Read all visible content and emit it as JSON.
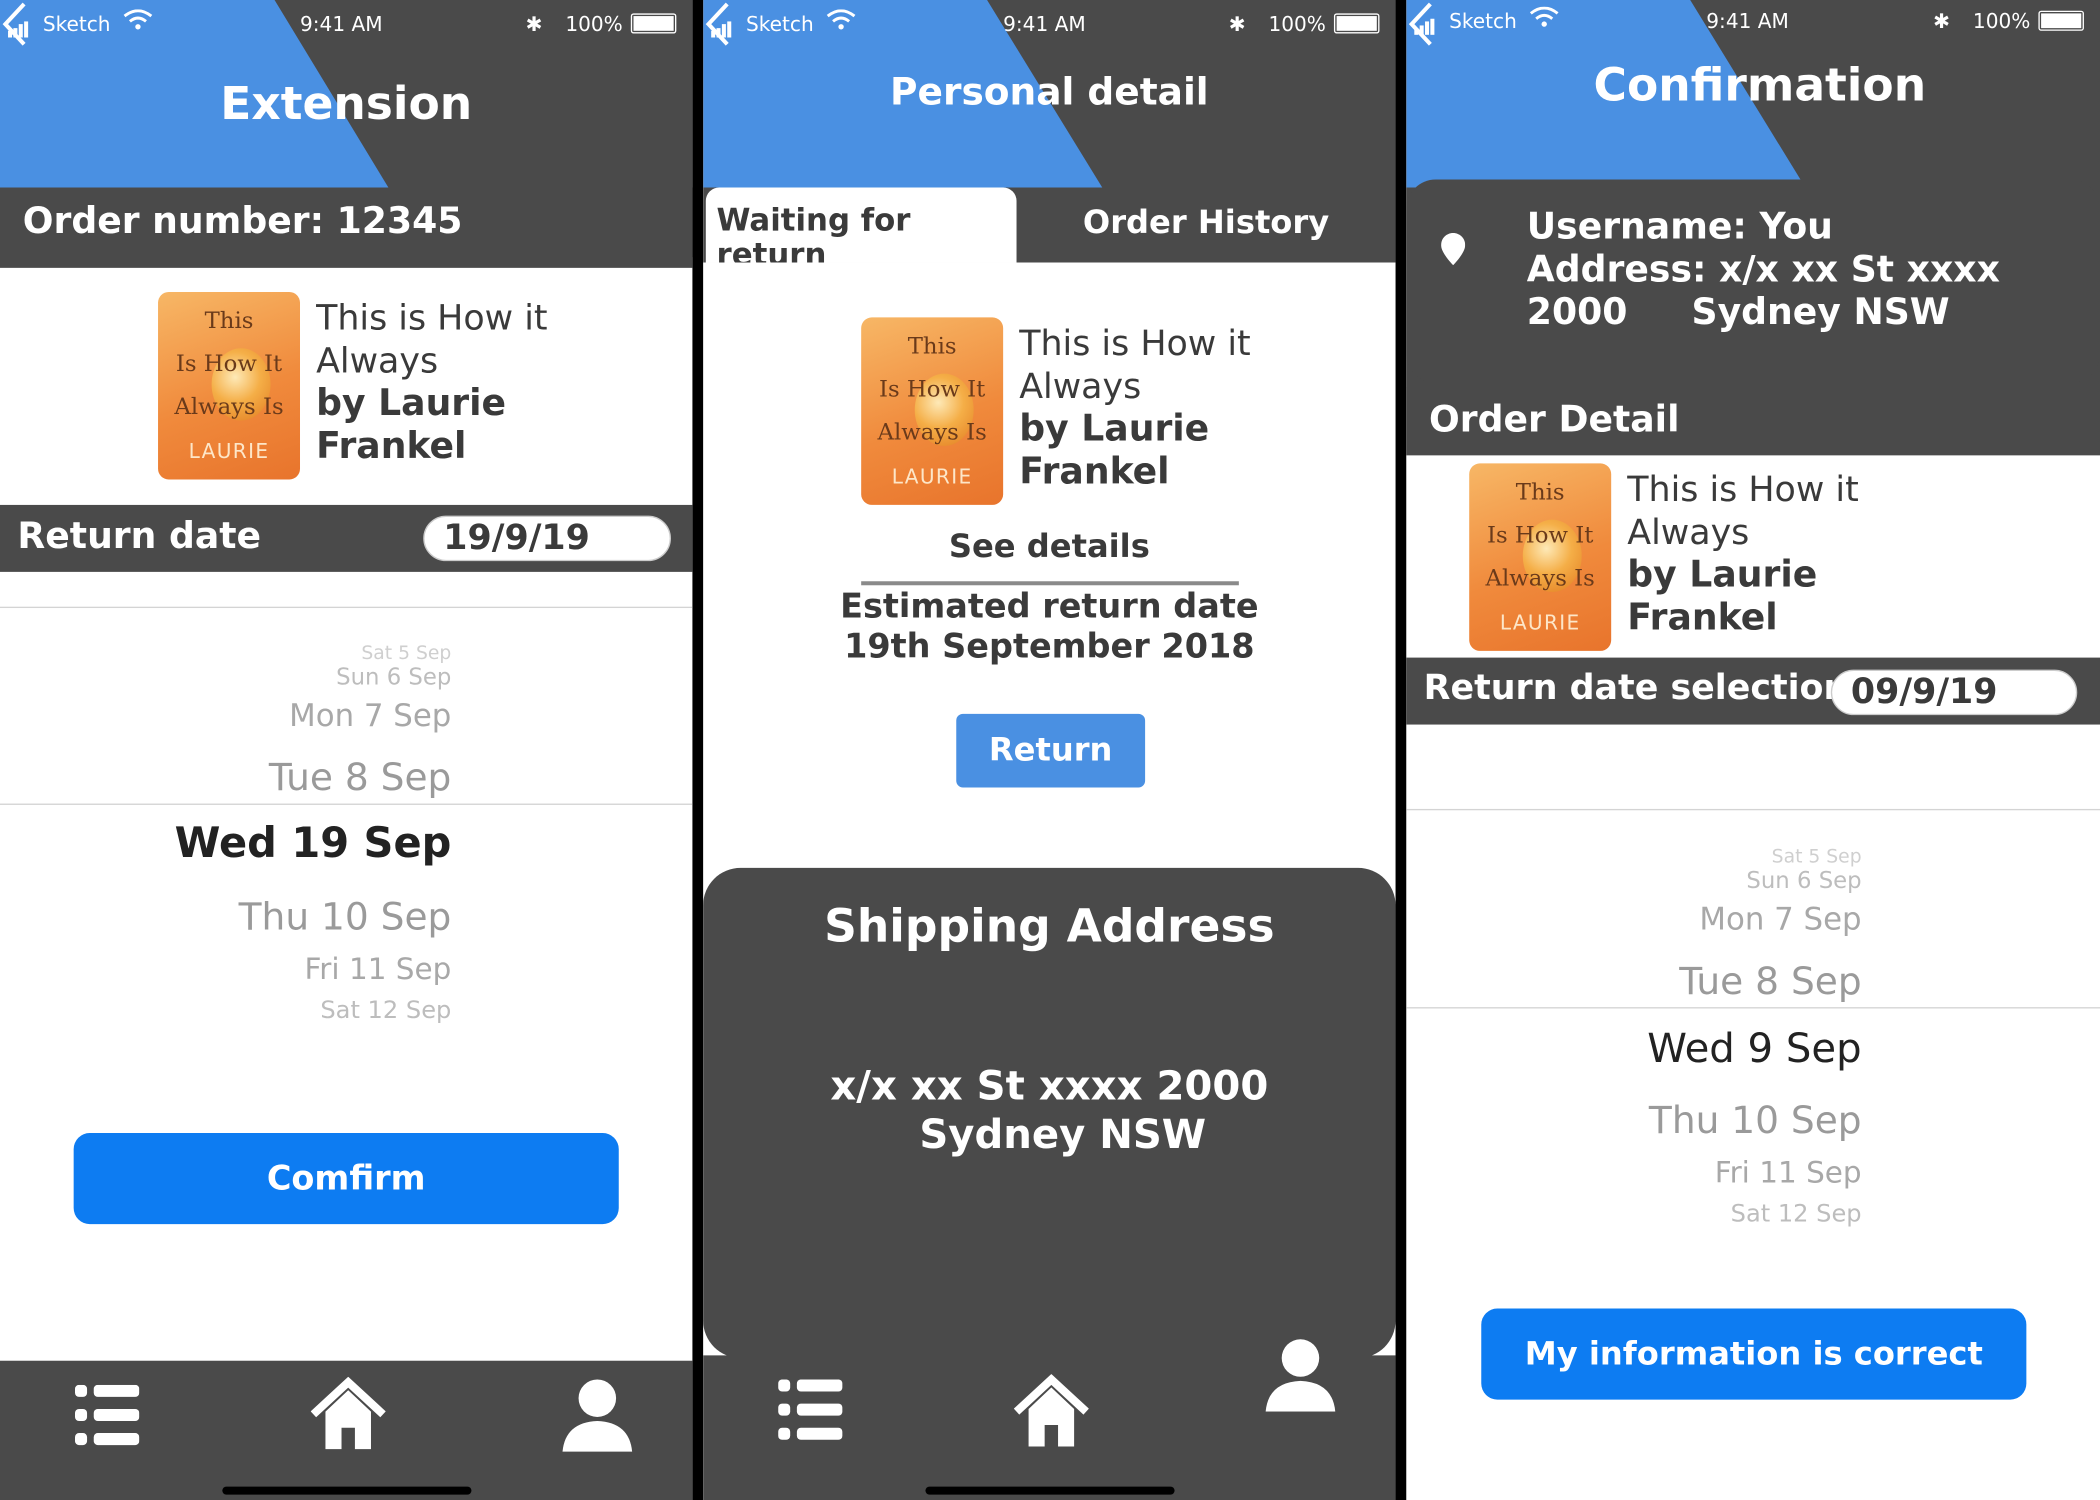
{
  "status_bar": {
    "carrier": "Sketch",
    "time": "9:41 AM",
    "battery": "100%"
  },
  "screen1": {
    "title": "Extension",
    "order_label": "Order number: 12345",
    "book": {
      "cover_line1": "This",
      "cover_line2": "Is How It",
      "cover_line3": "Always Is",
      "cover_author": "LAURIE",
      "title": "This is How it Always",
      "author": "by Laurie Frankel"
    },
    "return_label": "Return date",
    "return_value": "19/9/19",
    "picker": [
      "Sat 5 Sep",
      "Sun 6 Sep",
      "Mon 7 Sep",
      "Tue 8 Sep",
      "Wed 19 Sep",
      "Thu 10 Sep",
      "Fri 11 Sep",
      "Sat 12 Sep"
    ],
    "confirm": "Comfirm"
  },
  "screen2": {
    "title": "Personal detail",
    "tab_active": "Waiting for return",
    "tab_inactive": "Order History",
    "book": {
      "cover_line1": "This",
      "cover_line2": "Is How It",
      "cover_line3": "Always Is",
      "cover_author": "LAURIE",
      "title": "This is How it Always",
      "author": "by Laurie Frankel"
    },
    "see_details": "See details",
    "estimated_label": "Estimated return date",
    "estimated_value": "19th September 2018",
    "return_button": "Return",
    "shipping_title": "Shipping Address",
    "address_line1": "x/x xx St xxxx 2000",
    "address_line2": "Sydney NSW"
  },
  "screen3": {
    "title": "Confirmation",
    "username": "Username: You",
    "address": "Address: x/x xx St xxxx 2000",
    "address2": "Sydney NSW",
    "order_detail": "Order Detail",
    "book": {
      "cover_line1": "This",
      "cover_line2": "Is How It",
      "cover_line3": "Always Is",
      "cover_author": "LAURIE",
      "title": "This is How it Always",
      "author": "by Laurie Frankel"
    },
    "return_label": "Return date selection",
    "return_value": "09/9/19",
    "picker": [
      "Sat 5 Sep",
      "Sun 6 Sep",
      "Mon 7 Sep",
      "Tue 8 Sep",
      "Wed 9 Sep",
      "Thu 10 Sep",
      "Fri 11 Sep",
      "Sat 12 Sep"
    ],
    "confirm": "My information is correct"
  },
  "colors": {
    "header_blue": "#4a90e2",
    "dark": "#4a4a4a",
    "button_blue": "#0d7cf2"
  },
  "icons": {
    "back": "chevron-left-icon",
    "list": "list-icon",
    "home": "home-icon",
    "profile": "user-icon",
    "pin": "location-pin-icon"
  }
}
